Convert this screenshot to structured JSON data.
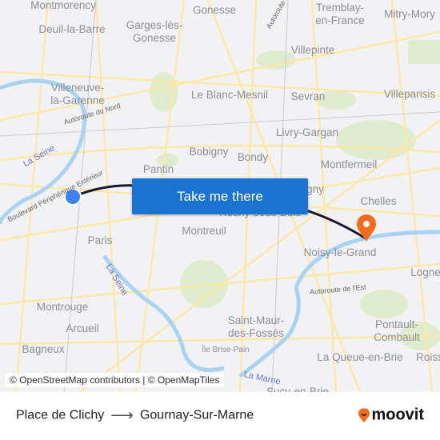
{
  "map": {
    "places": [
      {
        "id": "montmorency",
        "text": "Montmorency"
      },
      {
        "id": "deuil",
        "text": "Deuil-la-Barre"
      },
      {
        "id": "garges",
        "text": "Garges-lès-\nGonesse"
      },
      {
        "id": "gonesse",
        "text": "Gonesse"
      },
      {
        "id": "tremblay",
        "text": "Tremblay-\nen-France"
      },
      {
        "id": "mitry",
        "text": "Mitry-Mory"
      },
      {
        "id": "villepinte",
        "text": "Villepinte"
      },
      {
        "id": "villeneuve",
        "text": "Villeneuve-\nla-Garenne"
      },
      {
        "id": "blancmesnil",
        "text": "Le Blanc-Mesnil"
      },
      {
        "id": "sevran",
        "text": "Sevran"
      },
      {
        "id": "villeparisis",
        "text": "Villeparisis"
      },
      {
        "id": "livry",
        "text": "Livry-Gargan"
      },
      {
        "id": "bobigny",
        "text": "Bobigny"
      },
      {
        "id": "bondy",
        "text": "Bondy"
      },
      {
        "id": "montfermeil",
        "text": "Montfermeil"
      },
      {
        "id": "pantin",
        "text": "Pantin"
      },
      {
        "id": "gagny",
        "text": "Gagny"
      },
      {
        "id": "chelles",
        "text": "Chelles"
      },
      {
        "id": "rosny",
        "text": "Rosny-sous-Bois"
      },
      {
        "id": "montreuil",
        "text": "Montreuil"
      },
      {
        "id": "paris",
        "text": "Paris"
      },
      {
        "id": "noisy",
        "text": "Noisy-le-Grand"
      },
      {
        "id": "logne",
        "text": "Logne"
      },
      {
        "id": "montrouge",
        "text": "Montrouge"
      },
      {
        "id": "arcueil",
        "text": "Arcueil"
      },
      {
        "id": "saintmaur",
        "text": "Saint-Maur-\ndes-Fossés"
      },
      {
        "id": "pontault",
        "text": "Pontault-\nCombault"
      },
      {
        "id": "bagneux",
        "text": "Bagneux"
      },
      {
        "id": "queue",
        "text": "La Queue-en-Brie"
      },
      {
        "id": "roiss",
        "text": "Roiss"
      },
      {
        "id": "sucy",
        "text": "Sucy-en-Brie"
      },
      {
        "id": "brisepain",
        "text": "Île Brise-Pain"
      }
    ],
    "roads": {
      "autoroute_nord": "Autoroute du Nord",
      "autoroute_top": "Autoroute",
      "peripherique": "Boulevard Périphérique Extérieur",
      "autoroute_est": "Autoroute de l'Est"
    },
    "water": {
      "seine1": "La Seine",
      "seine2": "La Seine",
      "marne": "La Marne"
    },
    "route_color": "#1a1a2e",
    "origin_color": "#3b82f6",
    "destination_color": "#f26b1d"
  },
  "cta": {
    "label": "Take me there"
  },
  "attribution": "© OpenStreetMap contributors | © OpenMapTiles",
  "footer": {
    "origin": "Place de Clichy",
    "destination": "Gournay-Sur-Marne",
    "arrow": "⟶",
    "brand": "moovit",
    "brand_color": "#f26b1d"
  }
}
